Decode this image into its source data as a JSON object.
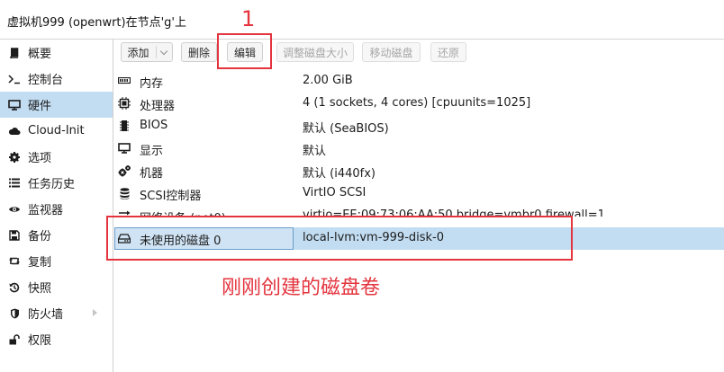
{
  "window": {
    "title": "虚拟机999 (openwrt)在节点'g'上"
  },
  "sidebar": {
    "items": [
      {
        "label": "概要",
        "icon": "book-icon"
      },
      {
        "label": "控制台",
        "icon": "terminal-icon"
      },
      {
        "label": "硬件",
        "icon": "monitor-icon",
        "active": true
      },
      {
        "label": "Cloud-Init",
        "icon": "cloud-icon"
      },
      {
        "label": "选项",
        "icon": "gear-icon"
      },
      {
        "label": "任务历史",
        "icon": "list-icon"
      },
      {
        "label": "监视器",
        "icon": "eye-icon"
      },
      {
        "label": "备份",
        "icon": "floppy-icon"
      },
      {
        "label": "复制",
        "icon": "retweet-icon"
      },
      {
        "label": "快照",
        "icon": "history-icon"
      },
      {
        "label": "防火墙",
        "icon": "shield-icon",
        "has_submenu": true
      },
      {
        "label": "权限",
        "icon": "unlock-icon"
      }
    ]
  },
  "toolbar": {
    "add_label": "添加",
    "delete_label": "删除",
    "edit_label": "编辑",
    "resize_label": "调整磁盘大小",
    "move_label": "移动磁盘",
    "revert_label": "还原"
  },
  "hardware": {
    "rows": [
      {
        "key": "内存",
        "value": "2.00 GiB",
        "icon": "memory-icon"
      },
      {
        "key": "处理器",
        "value": "4 (1 sockets, 4 cores) [cpuunits=1025]",
        "icon": "cpu-icon"
      },
      {
        "key": "BIOS",
        "value": "默认 (SeaBIOS)",
        "icon": "microchip-icon"
      },
      {
        "key": "显示",
        "value": "默认",
        "icon": "desktop-icon"
      },
      {
        "key": "机器",
        "value": "默认 (i440fx)",
        "icon": "cogs-icon"
      },
      {
        "key": "SCSI控制器",
        "value": "VirtIO SCSI",
        "icon": "database-icon"
      },
      {
        "key": "网络设备 (net0)",
        "value": "virtio=EE:09:73:06:AA:50,bridge=vmbr0,firewall=1",
        "icon": "exchange-icon"
      },
      {
        "key": "未使用的磁盘 0",
        "value": "local-lvm:vm-999-disk-0",
        "icon": "hdd-icon",
        "selected": true
      }
    ]
  },
  "annotations": {
    "step_number": "1",
    "note": "刚刚创建的磁盘卷",
    "color": "#e4343e"
  },
  "colors": {
    "selection": "#c2ddf2",
    "accent": "#e4343e"
  }
}
